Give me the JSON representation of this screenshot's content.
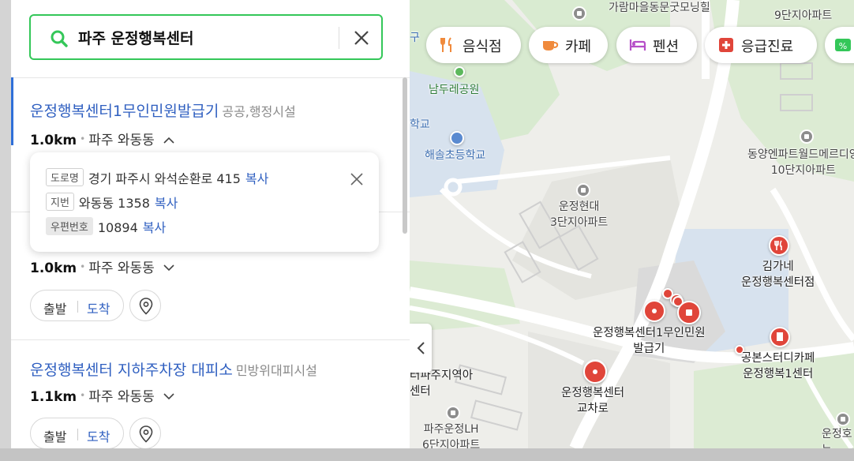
{
  "search": {
    "query": "파주 운정행복센터"
  },
  "results": [
    {
      "title": "운정행복센터1무인민원발급기",
      "category": "공공,행정시설",
      "distance": "1.0km",
      "area": "파주 와동동"
    },
    {
      "title": "",
      "category": "",
      "distance": "1.0km",
      "area": "파주 와동동",
      "start_label": "출발",
      "arrive_label": "도착"
    },
    {
      "title": "운정행복센터 지하주차장 대피소",
      "category": "민방위대피시설",
      "distance": "1.1km",
      "area": "파주 와동동",
      "start_label": "출발",
      "arrive_label": "도착"
    }
  ],
  "address_popup": {
    "road_tag": "도로명",
    "road_address": "경기 파주시 와석순환로 415",
    "jibun_tag": "지번",
    "jibun_address": "와동동 1358",
    "postal_tag": "우편번호",
    "postal_code": "10894",
    "copy_label": "복사"
  },
  "map": {
    "chips": [
      {
        "label": "음식점",
        "icon": "fork-knife-icon",
        "color": "#f08a3c"
      },
      {
        "label": "카페",
        "icon": "coffee-cup-icon",
        "color": "#f08a3c"
      },
      {
        "label": "펜션",
        "icon": "bed-icon",
        "color": "#b64fc8"
      },
      {
        "label": "응급진료",
        "icon": "medical-cross-icon",
        "color": "#e0453a"
      },
      {
        "label": "%",
        "icon": "percent-icon",
        "color": "#34c759"
      }
    ],
    "labels": {
      "park": "남두레공원",
      "school": "해솔초등학교",
      "school_partial": "학교",
      "top_partial": "9단지아파트",
      "top_partial2": "가람마을동문굿모닝힐",
      "top_left_partial": "구",
      "apt_dongyang_1": "동양엔파트월드메르디앙",
      "apt_dongyang_2": "10단지아파트",
      "apt_hyundai_1": "운정현대",
      "apt_hyundai_2": "3단지아파트",
      "restaurant_1": "김가네",
      "restaurant_2": "운정행복센터점",
      "kiosk_1": "운정행복센터1무인민원",
      "kiosk_2": "발급기",
      "cafe_1": "공본스터디카페",
      "cafe_2": "운정행복1센터",
      "station_1": "터파주지역아",
      "station_2": "센터",
      "intersection_1": "운정행복센터",
      "intersection_2": "교차로",
      "lh_1": "파주운정LH",
      "lh_2": "6단지아파트",
      "right_partial_1": "운정호",
      "right_partial_2": "누"
    }
  }
}
